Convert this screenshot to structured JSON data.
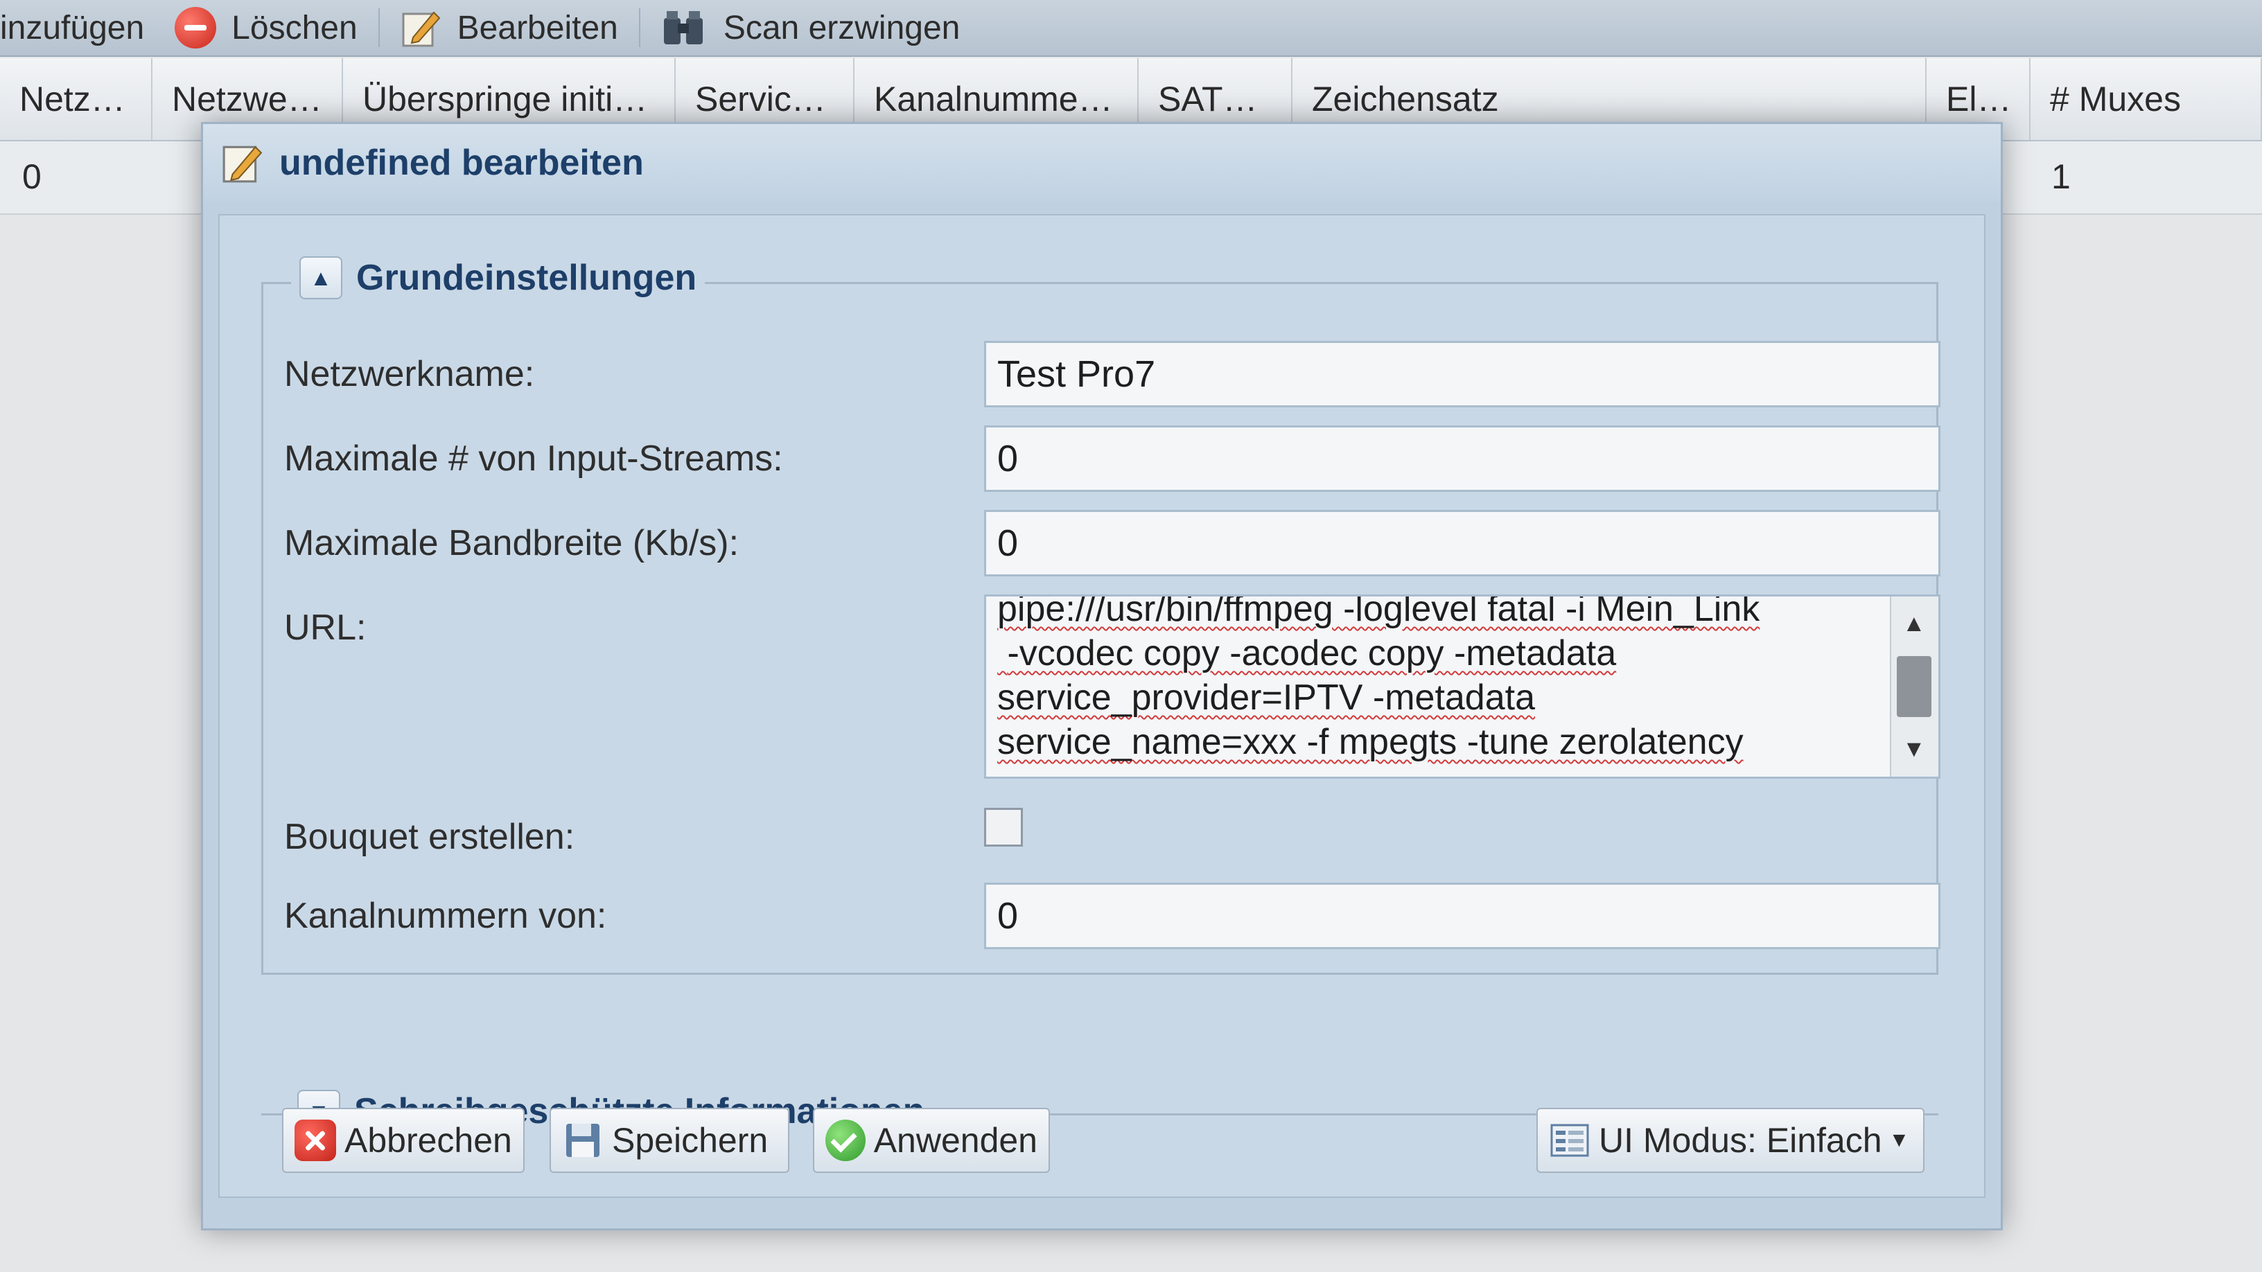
{
  "toolbar": {
    "add_label": "inzufügen",
    "delete_label": "Löschen",
    "edit_label": "Bearbeiten",
    "scan_label": "Scan erzwingen"
  },
  "grid": {
    "columns": [
      "Netz…",
      "Netzwe…",
      "Überspringe initi…",
      "Servic…",
      "Kanalnumme…",
      "SAT…",
      "Zeichensatz",
      "El…",
      "# Muxes"
    ],
    "row": {
      "first": "0",
      "muxes": "1"
    }
  },
  "dialog": {
    "title": "undefined bearbeiten",
    "section_basic": "Grundeinstellungen",
    "section_readonly": "Schreibgeschützte Informationen",
    "fields": {
      "network_name": {
        "label": "Netzwerkname:",
        "value": "Test Pro7"
      },
      "max_streams": {
        "label": "Maximale # von Input-Streams:",
        "value": "0"
      },
      "max_bandwidth": {
        "label": "Maximale Bandbreite (Kb/s):",
        "value": "0"
      },
      "url": {
        "label": "URL:",
        "value": "pipe:///usr/bin/ffmpeg -loglevel fatal -i Mein_Link\n -vcodec copy -acodec copy -metadata\nservice_provider=IPTV -metadata\nservice_name=xxx -f mpegts -tune zerolatency"
      },
      "create_bouquet": {
        "label": "Bouquet erstellen:",
        "checked": false
      },
      "channel_numbers_from": {
        "label": "Kanalnummern von:",
        "value": "0"
      }
    },
    "buttons": {
      "cancel": "Abbrechen",
      "save": "Speichern",
      "apply": "Anwenden",
      "ui_mode": "UI Modus: Einfach"
    }
  }
}
